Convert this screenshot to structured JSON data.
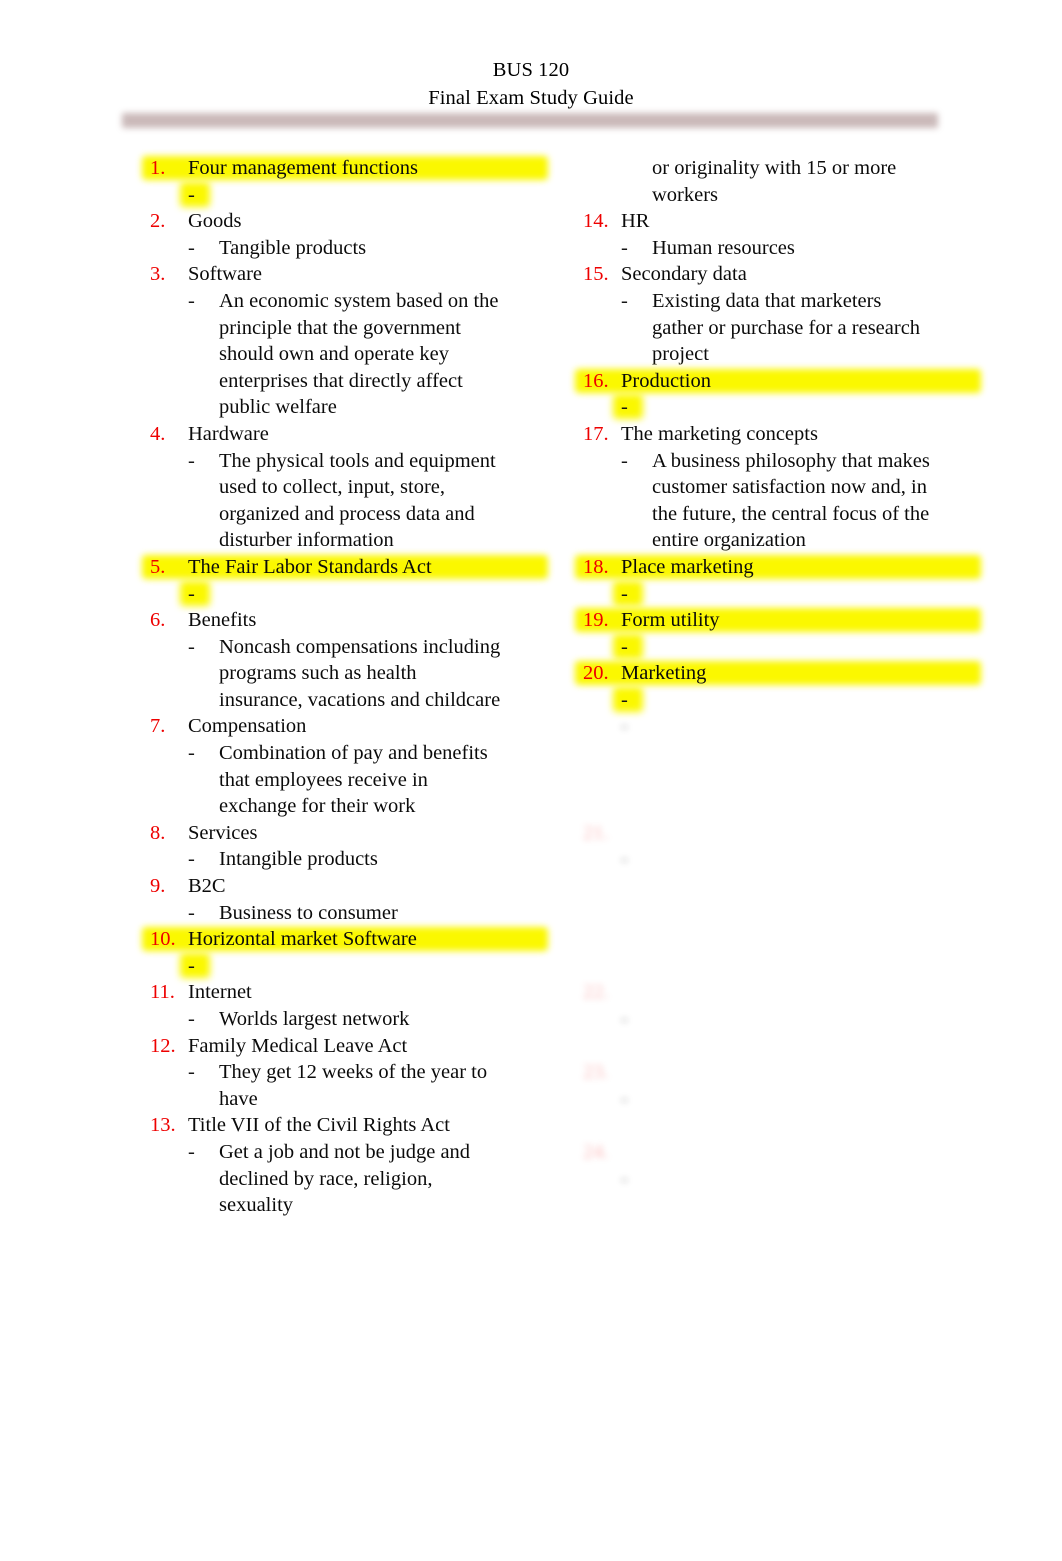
{
  "header": {
    "course": "BUS 120",
    "title": "Final Exam Study Guide",
    "rule_color": "#c8b6b6"
  },
  "colors": {
    "number": "#ee0000",
    "text": "#0b0b0b",
    "highlight": "#fbf800",
    "page_background": "#ffffff"
  },
  "columns": {
    "left": {
      "items": [
        {
          "n": "1.",
          "term": "Four management functions",
          "highlight": true,
          "subs": [
            {
              "text": "",
              "highlight": true
            }
          ]
        },
        {
          "n": "2.",
          "term": "Goods",
          "highlight": false,
          "subs": [
            {
              "text": "Tangible products",
              "highlight": false
            }
          ]
        },
        {
          "n": "3.",
          "term": "Software",
          "highlight": false,
          "subs": [
            {
              "text": "An economic system based on the principle that the government should own and operate key enterprises that directly affect public welfare",
              "highlight": false
            }
          ]
        },
        {
          "n": "4.",
          "term": "Hardware",
          "highlight": false,
          "subs": [
            {
              "text": "The physical tools and equipment used to collect, input, store, organized and process data and disturber information",
              "highlight": false
            }
          ]
        },
        {
          "n": "5.",
          "term": "The Fair Labor Standards Act",
          "highlight": true,
          "subs": [
            {
              "text": "",
              "highlight": true
            }
          ]
        },
        {
          "n": "6.",
          "term": "Benefits",
          "highlight": false,
          "subs": [
            {
              "text": "Noncash compensations including programs such as health insurance, vacations and childcare",
              "highlight": false
            }
          ]
        },
        {
          "n": "7.",
          "term": "Compensation",
          "highlight": false,
          "subs": [
            {
              "text": "Combination of pay and benefits that employees receive in exchange for their work",
              "highlight": false
            }
          ]
        },
        {
          "n": "8.",
          "term": "Services",
          "highlight": false,
          "subs": [
            {
              "text": "Intangible products",
              "highlight": false
            }
          ]
        },
        {
          "n": "9.",
          "term": "B2C",
          "highlight": false,
          "subs": [
            {
              "text": "Business to consumer",
              "highlight": false
            }
          ]
        },
        {
          "n": "10.",
          "term": "Horizontal market Software",
          "highlight": true,
          "subs": [
            {
              "text": "",
              "highlight": true
            }
          ]
        },
        {
          "n": "11.",
          "term": "Internet",
          "highlight": false,
          "subs": [
            {
              "text": "Worlds largest network",
              "highlight": false
            }
          ]
        },
        {
          "n": "12.",
          "term": "Family Medical Leave Act",
          "highlight": false,
          "subs": [
            {
              "text": "They get 12 weeks of the year to have",
              "highlight": false
            }
          ]
        },
        {
          "n": "13.",
          "term": "Title VII of the Civil Rights Act",
          "highlight": false,
          "subs": [
            {
              "text": "Get a job and not be judge and declined by race, religion, sexuality",
              "highlight": false
            }
          ]
        }
      ]
    },
    "right": {
      "continuation": "or originality with 15 or more workers",
      "items": [
        {
          "n": "14.",
          "term": "HR",
          "highlight": false,
          "blurred": false,
          "subs": [
            {
              "text": "Human resources",
              "highlight": false
            }
          ]
        },
        {
          "n": "15.",
          "term": "Secondary data",
          "highlight": false,
          "blurred": false,
          "subs": [
            {
              "text": "Existing data that marketers gather or purchase for a research project",
              "highlight": false
            }
          ]
        },
        {
          "n": "16.",
          "term": "Production",
          "highlight": true,
          "blurred": false,
          "subs": [
            {
              "text": "",
              "highlight": true
            }
          ]
        },
        {
          "n": "17.",
          "term": "The marketing concepts",
          "highlight": false,
          "blurred": false,
          "subs": [
            {
              "text": "A business philosophy that makes customer satisfaction now and, in the future, the central focus of the entire organization",
              "highlight": false
            }
          ]
        },
        {
          "n": "18.",
          "term": "Place marketing",
          "highlight": true,
          "blurred": false,
          "subs": [
            {
              "text": "",
              "highlight": true
            }
          ]
        },
        {
          "n": "19.",
          "term": "Form utility",
          "highlight": true,
          "blurred": false,
          "subs": [
            {
              "text": "",
              "highlight": true
            }
          ]
        },
        {
          "n": "20.",
          "term": "Marketing",
          "highlight": true,
          "blurred": false,
          "subs": [
            {
              "text": "",
              "highlight": true
            }
          ]
        }
      ],
      "blurred_items": [
        {
          "n": "",
          "term": "",
          "blurred": true,
          "subs": [
            {
              "text": "                                           "
            }
          ]
        },
        {
          "n": "21.",
          "term": "    ",
          "blurred": true,
          "subs": [
            {
              "text": "                                          "
            }
          ]
        },
        {
          "n": "22.",
          "term": "      ",
          "blurred": true,
          "subs": [
            {
              "text": "                        "
            }
          ]
        },
        {
          "n": "23.",
          "term": "       ",
          "blurred": true,
          "subs": [
            {
              "text": "                  "
            }
          ]
        },
        {
          "n": "24.",
          "term": "     ",
          "blurred": true,
          "subs": [
            {
              "text": "                                    "
            }
          ]
        }
      ]
    }
  }
}
